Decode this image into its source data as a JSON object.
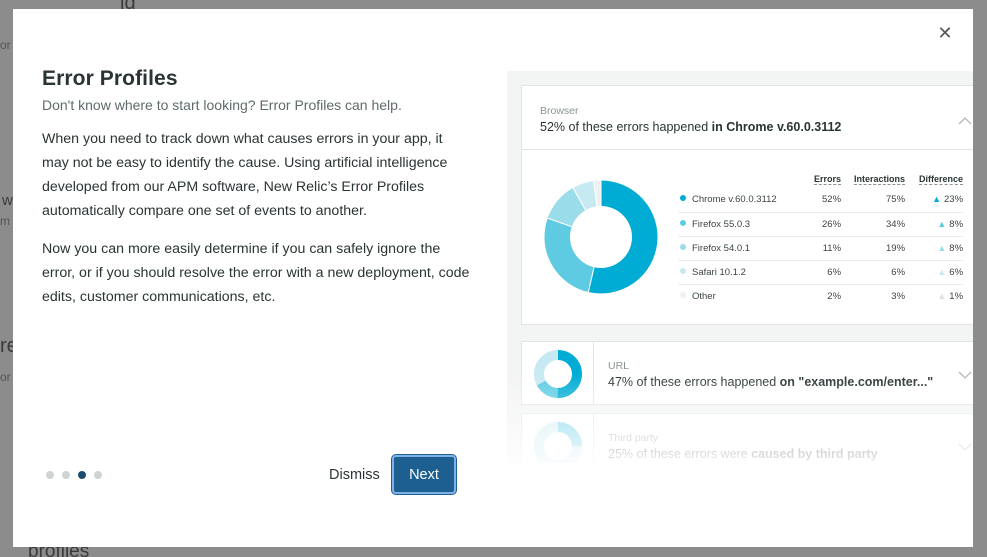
{
  "background": {
    "fragment_top": "ld",
    "fragment_or1": "or",
    "fragment_w": "w",
    "fragment_m": "m",
    "fragment_re": "re",
    "fragment_or2": "or",
    "fragment_bottom": "profiles"
  },
  "modal": {
    "close_icon": "close-icon",
    "title": "Error Profiles",
    "subtitle": "Don't know where to start looking? Error Profiles can help.",
    "paragraphs": [
      "When you need to track down what causes errors in your app, it may not be easy to identify the cause. Using artificial intelligence developed from our APM software, New Relic’s Error Profiles automatically compare one set of events to another.",
      "Now you can more easily determine if you can safely ignore the error, or if you should resolve the error with a new deployment, code edits, customer communications, etc."
    ],
    "pagination": {
      "total": 4,
      "current": 3
    },
    "dismiss_label": "Dismiss",
    "next_label": "Next"
  },
  "illustration": {
    "browser_card": {
      "category": "Browser",
      "text_prefix": "52% of these errors happened ",
      "text_bold": "in Chrome v.60.0.3112",
      "columns": [
        "Errors",
        "Interactions",
        "Difference"
      ],
      "rows": [
        {
          "name": "Chrome v.60.0.3112",
          "errors": "52%",
          "interactions": "75%",
          "difference": "23%",
          "color": "#00acd3"
        },
        {
          "name": "Firefox 55.0.3",
          "errors": "26%",
          "interactions": "34%",
          "difference": "8%",
          "color": "#5ecbe3"
        },
        {
          "name": "Firefox 54.0.1",
          "errors": "11%",
          "interactions": "19%",
          "difference": "8%",
          "color": "#9adcea"
        },
        {
          "name": "Safari 10.1.2",
          "errors": "6%",
          "interactions": "6%",
          "difference": "6%",
          "color": "#c7eaf2"
        },
        {
          "name": "Other",
          "errors": "2%",
          "interactions": "3%",
          "difference": "1%",
          "color": "#eef1f2"
        }
      ]
    },
    "url_card": {
      "category": "URL",
      "text_prefix": "47% of these errors happened ",
      "text_bold": "on \"example.com/enter...\""
    },
    "third_party_card": {
      "category": "Third party",
      "text_prefix": "25% of these errors were ",
      "text_bold": "caused by third party"
    }
  }
}
